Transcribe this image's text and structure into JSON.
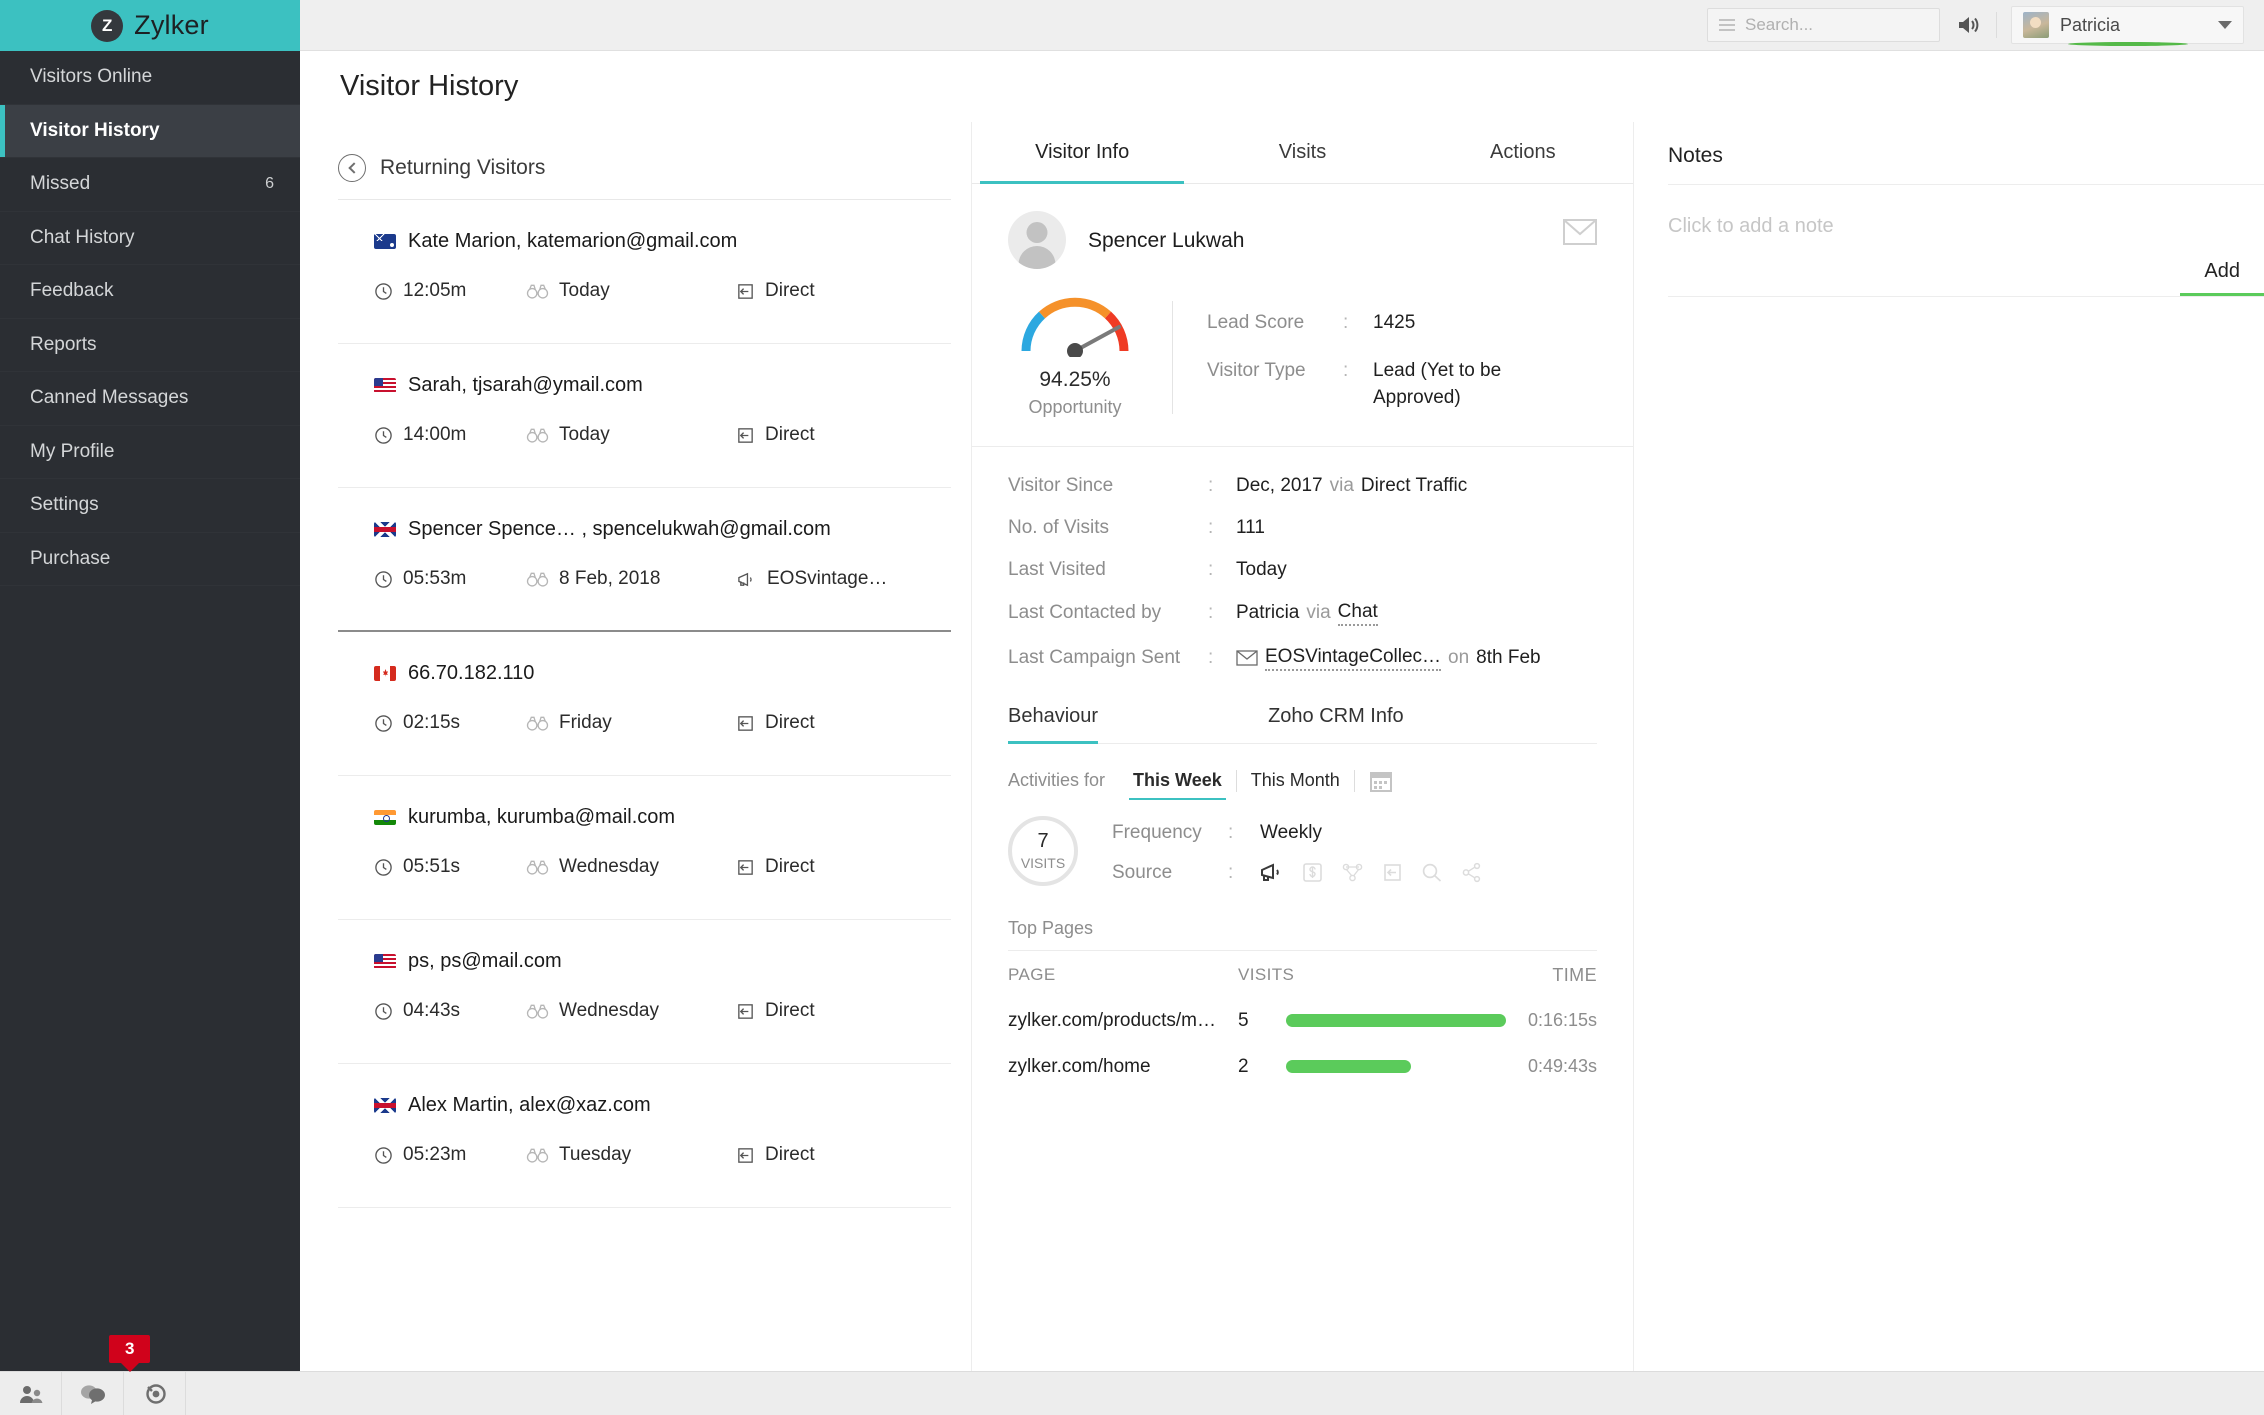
{
  "brand": {
    "logo_letter": "Z",
    "name": "Zylker"
  },
  "topbar": {
    "search_placeholder": "Search...",
    "user_name": "Patricia",
    "icons": {
      "menu": "hamburger-icon",
      "sound": "speaker-icon",
      "caret": "chevron-down-icon"
    }
  },
  "sidebar": {
    "items": [
      {
        "label": "Visitors Online",
        "badge": "",
        "active": false
      },
      {
        "label": "Visitor History",
        "badge": "",
        "active": true
      },
      {
        "label": "Missed",
        "badge": "6",
        "active": false
      },
      {
        "label": "Chat History",
        "badge": "",
        "active": false
      },
      {
        "label": "Feedback",
        "badge": "",
        "active": false
      },
      {
        "label": "Reports",
        "badge": "",
        "active": false
      },
      {
        "label": "Canned Messages",
        "badge": "",
        "active": false
      },
      {
        "label": "My Profile",
        "badge": "",
        "active": false
      },
      {
        "label": "Settings",
        "badge": "",
        "active": false
      },
      {
        "label": "Purchase",
        "badge": "",
        "active": false
      }
    ]
  },
  "page": {
    "title": "Visitor History"
  },
  "visitor_list": {
    "header": "Returning Visitors",
    "rows": [
      {
        "flag": "au",
        "name": "Kate Marion, katemarion@gmail.com",
        "duration": "12:05m",
        "visited": "Today",
        "source": "Direct",
        "source_icon": "direct-arrow-icon"
      },
      {
        "flag": "us",
        "name": "Sarah, tjsarah@ymail.com",
        "duration": "14:00m",
        "visited": "Today",
        "source": "Direct",
        "source_icon": "direct-arrow-icon"
      },
      {
        "flag": "gb",
        "name": "Spencer Spence… , spencelukwah@gmail.com",
        "duration": "05:53m",
        "visited": "8 Feb, 2018",
        "source": "EOSvintage…",
        "source_icon": "megaphone-icon"
      },
      {
        "flag": "ca",
        "name": "66.70.182.110",
        "duration": "02:15s",
        "visited": "Friday",
        "source": "Direct",
        "source_icon": "direct-arrow-icon"
      },
      {
        "flag": "in",
        "name": "kurumba, kurumba@mail.com",
        "duration": "05:51s",
        "visited": "Wednesday",
        "source": "Direct",
        "source_icon": "direct-arrow-icon"
      },
      {
        "flag": "us",
        "name": "ps, ps@mail.com",
        "duration": "04:43s",
        "visited": "Wednesday",
        "source": "Direct",
        "source_icon": "direct-arrow-icon"
      },
      {
        "flag": "gb",
        "name": "Alex Martin, alex@xaz.com",
        "duration": "05:23m",
        "visited": "Tuesday",
        "source": "Direct",
        "source_icon": "direct-arrow-icon"
      }
    ]
  },
  "center": {
    "tabs": [
      {
        "label": "Visitor Info",
        "active": true
      },
      {
        "label": "Visits",
        "active": false
      },
      {
        "label": "Actions",
        "active": false
      }
    ],
    "visitor_name": "Spencer Lukwah",
    "gauge": {
      "percent": "94.25%",
      "label": "Opportunity",
      "value": 94.25
    },
    "score": [
      {
        "key": "Lead Score",
        "sep": ":",
        "value": "1425"
      },
      {
        "key": "Visitor Type",
        "sep": ":",
        "value": "Lead (Yet to be Approved)"
      }
    ],
    "details": [
      {
        "key": "Visitor Since",
        "sep": ":",
        "v1": "Dec, 2017",
        "mid": "via",
        "v2": "Direct Traffic"
      },
      {
        "key": "No. of Visits",
        "sep": ":",
        "v1": "111",
        "mid": "",
        "v2": ""
      },
      {
        "key": "Last Visited",
        "sep": ":",
        "v1": "Today",
        "mid": "",
        "v2": ""
      },
      {
        "key": "Last Contacted by",
        "sep": ":",
        "v1": "Patricia",
        "mid": "via",
        "v2": "Chat"
      },
      {
        "key": "Last Campaign Sent",
        "sep": ":",
        "v1": "EOSVintageCollec…",
        "mid": "on",
        "v2": "8th Feb"
      }
    ],
    "subtabs": [
      {
        "label": "Behaviour",
        "active": true
      },
      {
        "label": "Zoho CRM Info",
        "active": false
      }
    ],
    "activities": {
      "label": "Activities for",
      "segments": [
        {
          "label": "This Week",
          "active": true
        },
        {
          "label": "This Month",
          "active": false
        }
      ],
      "calendar_icon": "calendar-icon"
    },
    "visits_badge": {
      "count": "7",
      "label": "VISITS"
    },
    "frequency": {
      "key": "Frequency",
      "sep": ":",
      "value": "Weekly"
    },
    "source": {
      "key": "Source",
      "sep": ":",
      "icons": [
        {
          "name": "megaphone-icon",
          "active": true
        },
        {
          "name": "dollar-icon",
          "active": false
        },
        {
          "name": "social-network-icon",
          "active": false
        },
        {
          "name": "direct-arrow-icon",
          "active": false
        },
        {
          "name": "search-icon",
          "active": false
        },
        {
          "name": "share-icon",
          "active": false
        }
      ]
    },
    "top_pages": {
      "title": "Top Pages",
      "columns": [
        "PAGE",
        "VISITS",
        "",
        "TIME"
      ],
      "rows": [
        {
          "page": "zylker.com/products/m…",
          "visits": "5",
          "bar_pct": 100,
          "time": "0:16:15s"
        },
        {
          "page": "zylker.com/home",
          "visits": "2",
          "bar_pct": 57,
          "time": "0:49:43s"
        }
      ]
    },
    "mail_icon": "envelope-icon"
  },
  "notes": {
    "title": "Notes",
    "placeholder": "Click to add a note",
    "add_label": "Add"
  },
  "bottombar": {
    "buttons": [
      {
        "icon": "people-icon"
      },
      {
        "icon": "chat-bubbles-icon"
      },
      {
        "icon": "bell-icon"
      }
    ],
    "badge": "3"
  },
  "colors": {
    "brand_teal": "#3cc1c1",
    "sidebar_dark": "#2b2e33",
    "green": "#5bcb5b",
    "red_badge": "#d0021b",
    "gauge_blue": "#2ca8e0",
    "gauge_orange": "#f5912a",
    "gauge_red": "#ef3b24"
  }
}
